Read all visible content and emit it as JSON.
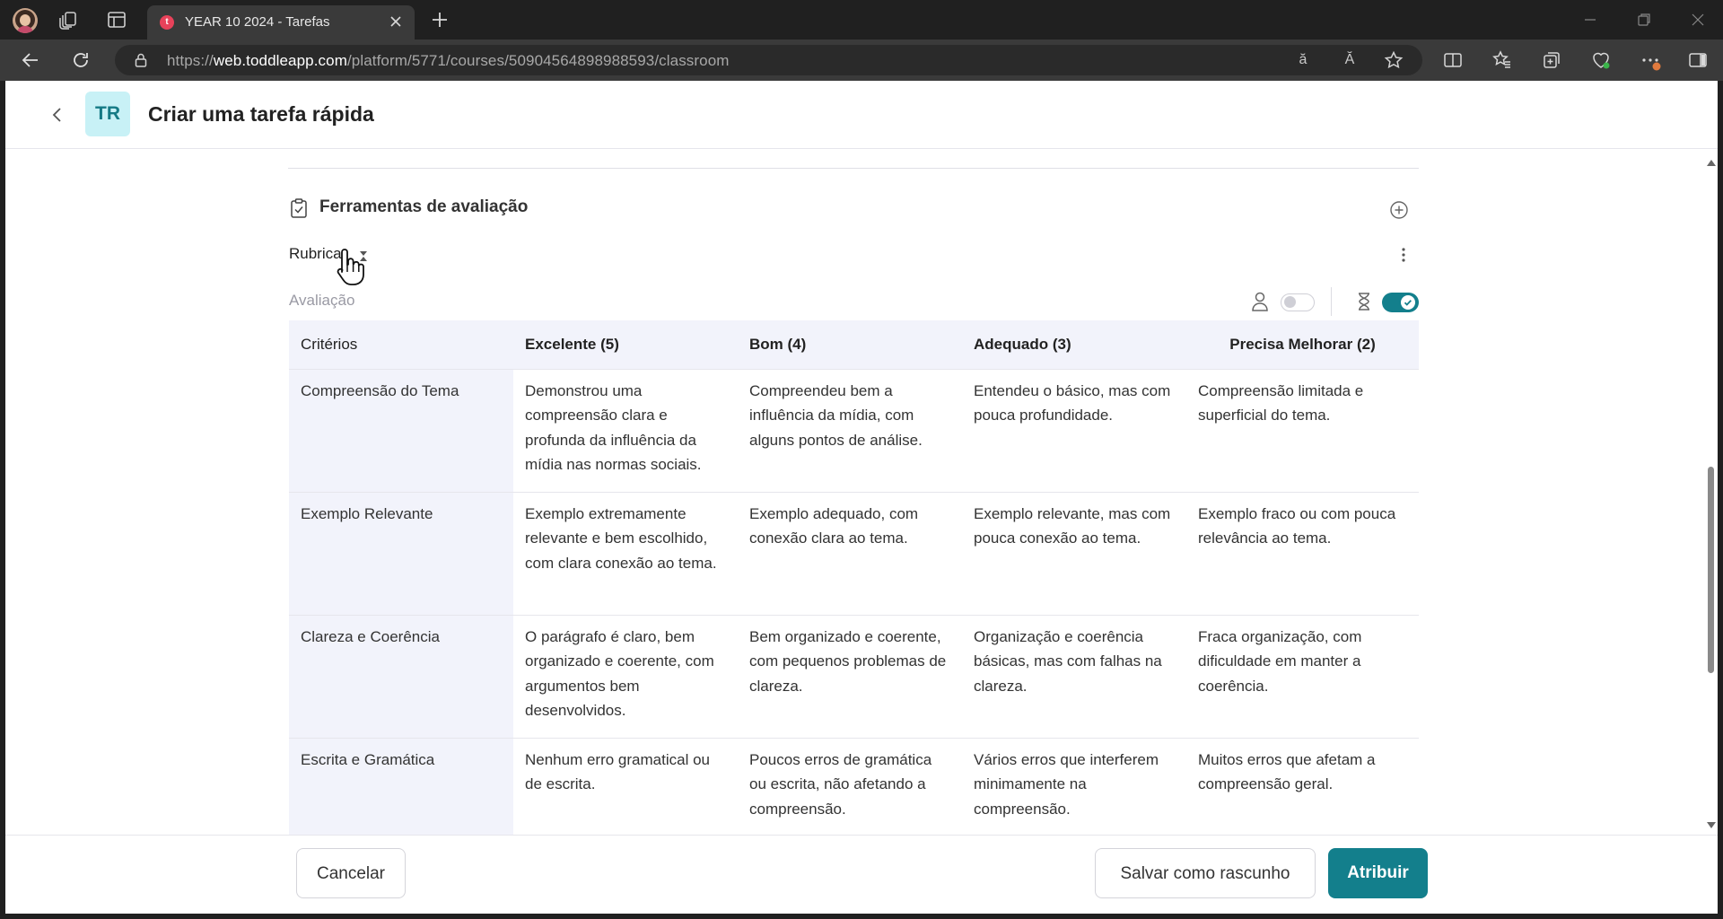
{
  "browser": {
    "tab": {
      "title": "YEAR 10 2024 - Tarefas",
      "favicon_letter": "t"
    },
    "url": {
      "prefix": "https://",
      "host": "web.toddleapp.com",
      "path": "/platform/5771/courses/50904564898988593/classroom"
    },
    "read_aloud_glyph": "Ă",
    "translate_glyph": "ă"
  },
  "header": {
    "avatar_initials": "TR",
    "title": "Criar uma tarefa rápida"
  },
  "assessment_tools": {
    "title": "Ferramentas de avaliação",
    "tool_name": "Rubrica",
    "subtitle": "Avaliação",
    "student_toggle_on": false,
    "timer_toggle_on": true
  },
  "rubric": {
    "headers": [
      "Critérios",
      "Excelente (5)",
      "Bom (4)",
      "Adequado (3)",
      "Precisa Melhorar (2)"
    ],
    "rows": [
      {
        "criterion": "Compreensão do Tema",
        "levels": [
          "Demonstrou uma compreensão clara e profunda da influência da mídia nas normas sociais.",
          "Compreendeu bem a influência da mídia, com alguns pontos de análise.",
          "Entendeu o básico, mas com pouca profundidade.",
          "Compreensão limitada e superficial do tema."
        ]
      },
      {
        "criterion": "Exemplo Relevante",
        "levels": [
          "Exemplo extremamente relevante e bem escolhido, com clara conexão ao tema.",
          "Exemplo adequado, com conexão clara ao tema.",
          "Exemplo relevante, mas com pouca conexão ao tema.",
          "Exemplo fraco ou com pouca relevância ao tema."
        ]
      },
      {
        "criterion": "Clareza e Coerência",
        "levels": [
          "O parágrafo é claro, bem organizado e coerente, com argumentos bem desenvolvidos.",
          "Bem organizado e coerente, com pequenos problemas de clareza.",
          "Organização e coerência básicas, mas com falhas na clareza.",
          "Fraca organização, com dificuldade em manter a coerência."
        ]
      },
      {
        "criterion": "Escrita e Gramática",
        "levels": [
          "Nenhum erro gramatical ou de escrita.",
          "Poucos erros de gramática ou escrita, não afetando a compreensão.",
          "Vários erros que interferem minimamente na compreensão.",
          "Muitos erros que afetam a compreensão geral."
        ]
      }
    ]
  },
  "footer": {
    "cancel_label": "Cancelar",
    "draft_label": "Salvar como rascunho",
    "assign_label": "Atribuir"
  },
  "colors": {
    "accent": "#137f8c",
    "avatar_bg": "#c8f1f6",
    "table_header_bg": "#f2f3fb"
  }
}
